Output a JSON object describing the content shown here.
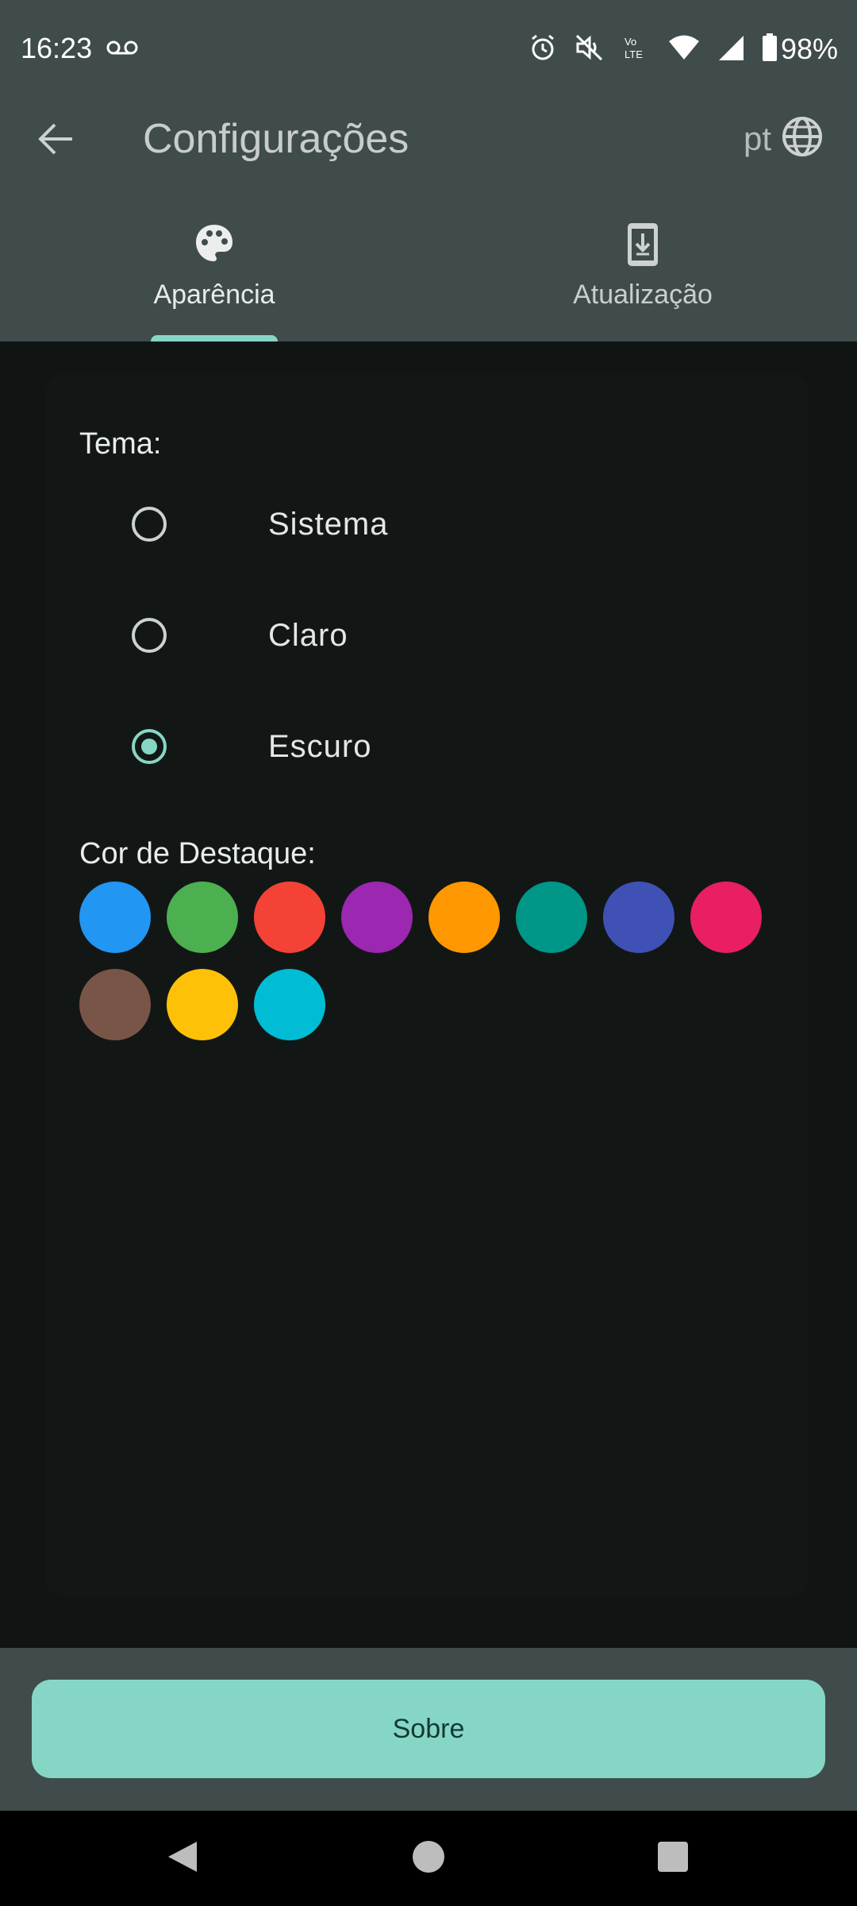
{
  "status_bar": {
    "time": "16:23",
    "battery": "98%",
    "icons": [
      "voicemail-icon",
      "alarm-icon",
      "mute-icon",
      "volte-icon",
      "wifi-icon",
      "signal-icon",
      "battery-icon"
    ]
  },
  "app_bar": {
    "title": "Configurações",
    "language": "pt",
    "back_icon": "arrow-back-icon",
    "language_icon": "globe-icon"
  },
  "tabs": [
    {
      "label": "Aparência",
      "icon": "palette-icon",
      "selected": true
    },
    {
      "label": "Atualização",
      "icon": "phone-download-icon",
      "selected": false
    }
  ],
  "theme": {
    "label": "Tema:",
    "options": [
      {
        "label": "Sistema",
        "selected": false
      },
      {
        "label": "Claro",
        "selected": false
      },
      {
        "label": "Escuro",
        "selected": true
      }
    ]
  },
  "accent": {
    "label": "Cor de Destaque:",
    "colors": [
      "#2196F3",
      "#4CAF50",
      "#F44336",
      "#9C27B0",
      "#FF9800",
      "#009688",
      "#3F51B5",
      "#E91E63",
      "#795548",
      "#FFC107",
      "#00BCD4"
    ]
  },
  "about_button": {
    "label": "Sobre"
  },
  "colors": {
    "app_bar": "#404b4b",
    "background": "#101514",
    "primary": "#86d6c6"
  }
}
